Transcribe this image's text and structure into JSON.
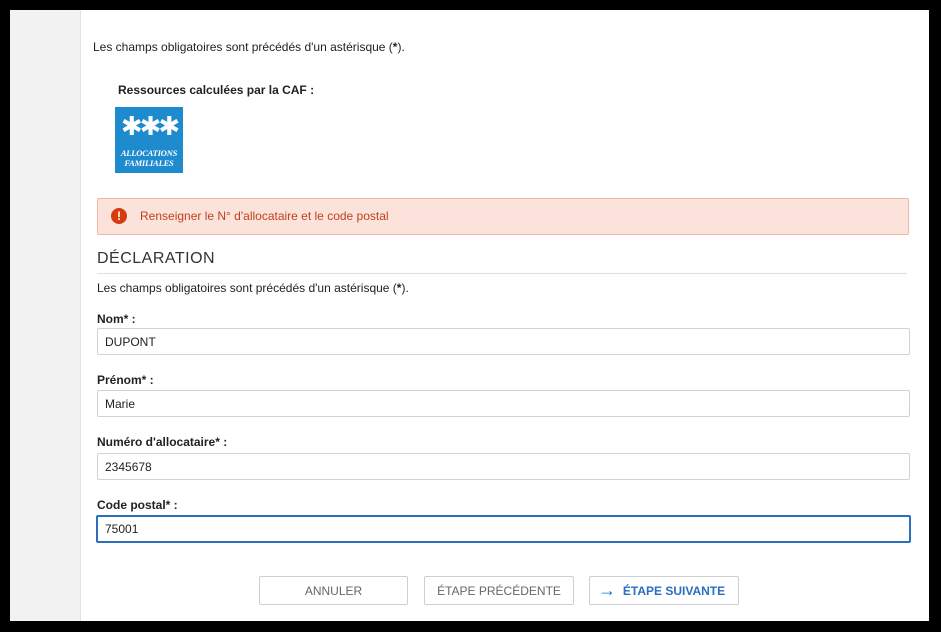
{
  "intro_text": "Les champs obligatoires sont précédés d'un astérisque (",
  "intro_asterisk": "*",
  "intro_end": ").",
  "resources_title": "Ressources calculées par la CAF :",
  "logo": {
    "line1": "ALLOCATIONS",
    "line2": "FAMILIALES",
    "color": "#1e8bcf"
  },
  "alert": {
    "icon": "!",
    "message": "Renseigner le N° d'allocataire et le code postal",
    "color": "#c0421c"
  },
  "section_title": "DÉCLARATION",
  "required_note": "Les champs obligatoires sont précédés d'un astérisque (",
  "required_asterisk": "*",
  "required_end": ").",
  "fields": {
    "nom": {
      "label": "Nom* :",
      "value": "DUPONT"
    },
    "prenom": {
      "label": "Prénom* :",
      "value": "Marie"
    },
    "numero": {
      "label": "Numéro d'allocataire* :",
      "value": "2345678"
    },
    "code_postal": {
      "label": "Code postal* :",
      "value": "75001"
    }
  },
  "buttons": {
    "cancel": "ANNULER",
    "previous": "ÉTAPE PRÉCÉDENTE",
    "next": "ÉTAPE SUIVANTE",
    "next_icon": "→"
  },
  "colors": {
    "accent": "#2a6fc0",
    "error_bg": "#fbe3dc",
    "error_icon": "#d83a0f"
  }
}
